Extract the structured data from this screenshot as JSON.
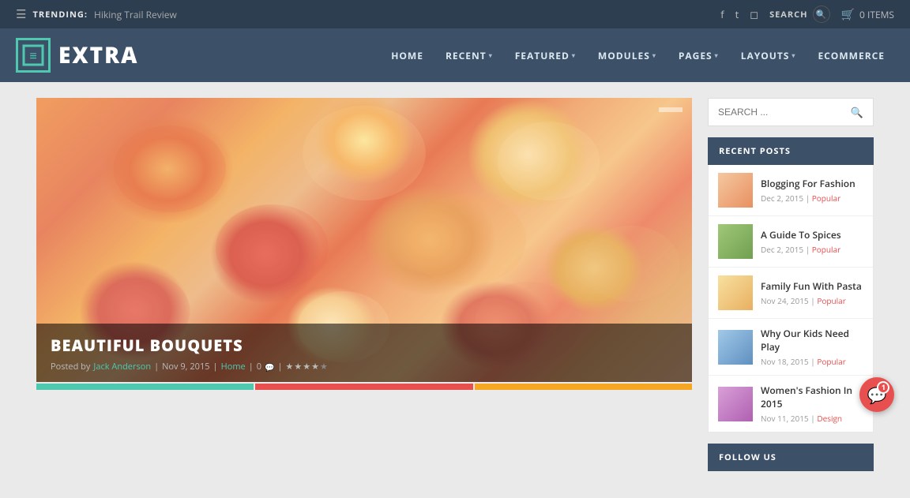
{
  "topbar": {
    "trending_label": "TRENDING:",
    "trending_text": "Hiking Trail Review",
    "search_label": "SEARCH",
    "cart_label": "0 ITEMS"
  },
  "header": {
    "logo_icon": "≡",
    "logo_text": "EXTRA",
    "nav_items": [
      {
        "label": "HOME",
        "has_arrow": false
      },
      {
        "label": "RECENT",
        "has_arrow": true
      },
      {
        "label": "FEATURED",
        "has_arrow": true
      },
      {
        "label": "MODULES",
        "has_arrow": true
      },
      {
        "label": "PAGES",
        "has_arrow": true
      },
      {
        "label": "LAYOUTS",
        "has_arrow": true
      },
      {
        "label": "ECOMMERCE",
        "has_arrow": false
      }
    ]
  },
  "hero": {
    "title": "BEAUTIFUL BOUQUETS",
    "meta_posted": "Posted by",
    "author": "Jack Anderson",
    "date": "Nov 9, 2015",
    "category": "Home",
    "comments": "0",
    "rating": 4
  },
  "sidebar": {
    "search_placeholder": "SEARCH ...",
    "recent_posts_label": "RECENT POSTS",
    "follow_us_label": "FOLLOW US",
    "posts": [
      {
        "title": "Blogging For Fashion",
        "date": "Dec 2, 2015",
        "tag": "Popular",
        "thumb": "fashion"
      },
      {
        "title": "A Guide To Spices",
        "date": "Dec 2, 2015",
        "tag": "Popular",
        "thumb": "spices"
      },
      {
        "title": "Family Fun With Pasta",
        "date": "Nov 24, 2015",
        "tag": "Popular",
        "thumb": "pasta"
      },
      {
        "title": "Why Our Kids Need Play",
        "date": "Nov 18, 2015",
        "tag": "Popular",
        "thumb": "kids"
      },
      {
        "title": "Women's Fashion In 2015",
        "date": "Nov 11, 2015",
        "tag": "Design",
        "thumb": "womens"
      }
    ]
  },
  "chat": {
    "badge": "1"
  }
}
